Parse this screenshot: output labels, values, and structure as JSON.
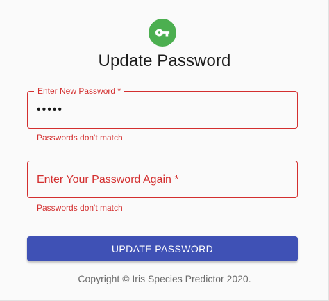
{
  "header": {
    "icon": "key-icon",
    "icon_bg_color": "#4caf50",
    "title": "Update Password"
  },
  "form": {
    "new_password": {
      "label": "Enter New Password *",
      "value": "•••••",
      "helper_text": "Passwords don't match",
      "state": "error"
    },
    "confirm_password": {
      "label": "Enter Your Password Again *",
      "value": "",
      "helper_text": "Passwords don't match",
      "state": "error"
    },
    "submit_label": "UPDATE PASSWORD",
    "error_color": "#d32f2f",
    "button_color": "#3f51b5"
  },
  "footer": {
    "text": "Copyright © Iris Species Predictor 2020."
  }
}
